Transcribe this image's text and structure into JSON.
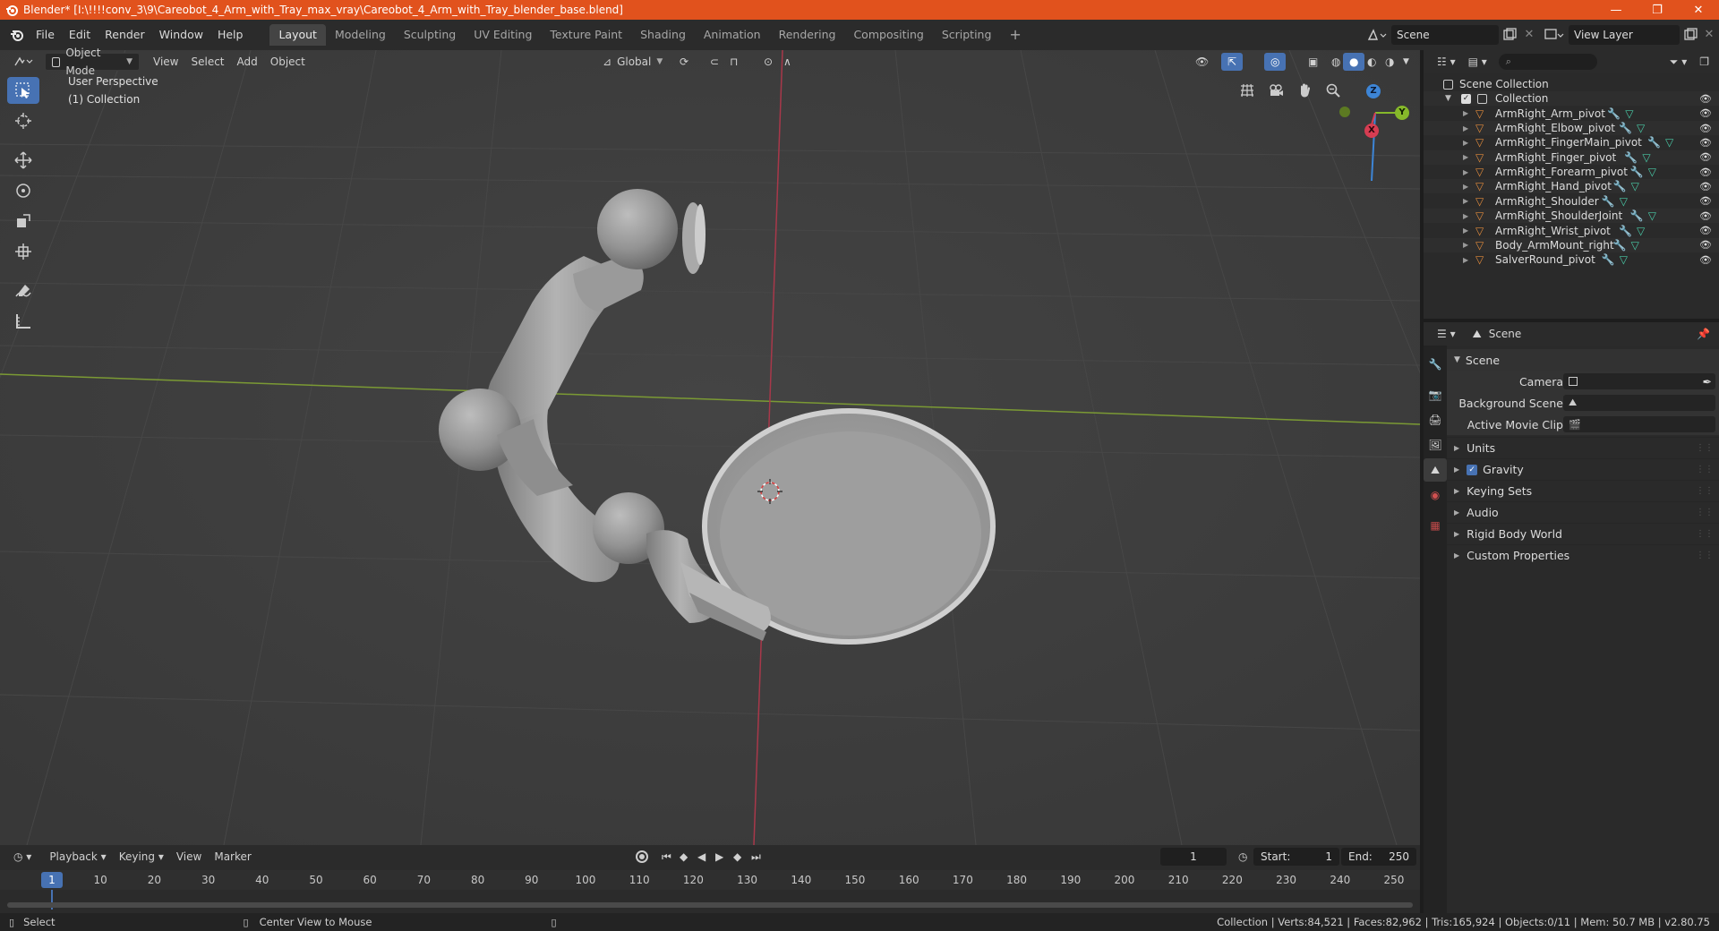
{
  "window": {
    "title": "Blender* [I:\\!!!!conv_3\\9\\Careobot_4_Arm_with_Tray_max_vray\\Careobot_4_Arm_with_Tray_blender_base.blend]",
    "controls": [
      "—",
      "❐",
      "✕"
    ]
  },
  "menu": [
    "File",
    "Edit",
    "Render",
    "Window",
    "Help"
  ],
  "workspaces": [
    "Layout",
    "Modeling",
    "Sculpting",
    "UV Editing",
    "Texture Paint",
    "Shading",
    "Animation",
    "Rendering",
    "Compositing",
    "Scripting"
  ],
  "active_workspace": "Layout",
  "scene_selector": "Scene",
  "view_layer_selector": "View Layer",
  "viewport": {
    "mode": "Object Mode",
    "menus": [
      "View",
      "Select",
      "Add",
      "Object"
    ],
    "transform_orientation": "Global",
    "info_line1": "User Perspective",
    "info_line2": "(1) Collection",
    "gizmo_axes": {
      "x": "X",
      "y": "Y",
      "z": "Z"
    }
  },
  "outliner": {
    "root": "Scene Collection",
    "collection": "Collection",
    "objects": [
      "ArmRight_Arm_pivot",
      "ArmRight_Elbow_pivot",
      "ArmRight_FingerMain_pivot",
      "ArmRight_Finger_pivot",
      "ArmRight_Forearm_pivot",
      "ArmRight_Hand_pivot",
      "ArmRight_Shoulder",
      "ArmRight_ShoulderJoint",
      "ArmRight_Wrist_pivot",
      "Body_ArmMount_right",
      "SalverRound_pivot"
    ]
  },
  "properties": {
    "header": "Scene",
    "panel_title": "Scene",
    "fields": [
      "Camera",
      "Background Scene",
      "Active Movie Clip"
    ],
    "subpanels": [
      "Units",
      "Gravity",
      "Keying Sets",
      "Audio",
      "Rigid Body World",
      "Custom Properties"
    ]
  },
  "timeline": {
    "menus": [
      "Playback",
      "Keying",
      "View",
      "Marker"
    ],
    "current_frame": "1",
    "start_label": "Start:",
    "start": "1",
    "end_label": "End:",
    "end": "250",
    "ruler_current": "1",
    "ruler_ticks": [
      "10",
      "20",
      "30",
      "40",
      "50",
      "60",
      "70",
      "80",
      "90",
      "100",
      "110",
      "120",
      "130",
      "140",
      "150",
      "160",
      "170",
      "180",
      "190",
      "200",
      "210",
      "220",
      "230",
      "240",
      "250"
    ]
  },
  "status": {
    "left": "Select",
    "middle": "Center View to Mouse",
    "right": "Collection | Verts:84,521 | Faces:82,962 | Tris:165,924 | Objects:0/11 | Mem: 50.7 MB | v2.80.75"
  },
  "colors": {
    "title_bar": "#e1521d",
    "accent": "#4772b3",
    "viewport_bg": "#3d3d3d",
    "x_axis": "#d63d52",
    "y_axis": "#86b92a",
    "z_axis": "#3d85d6"
  }
}
